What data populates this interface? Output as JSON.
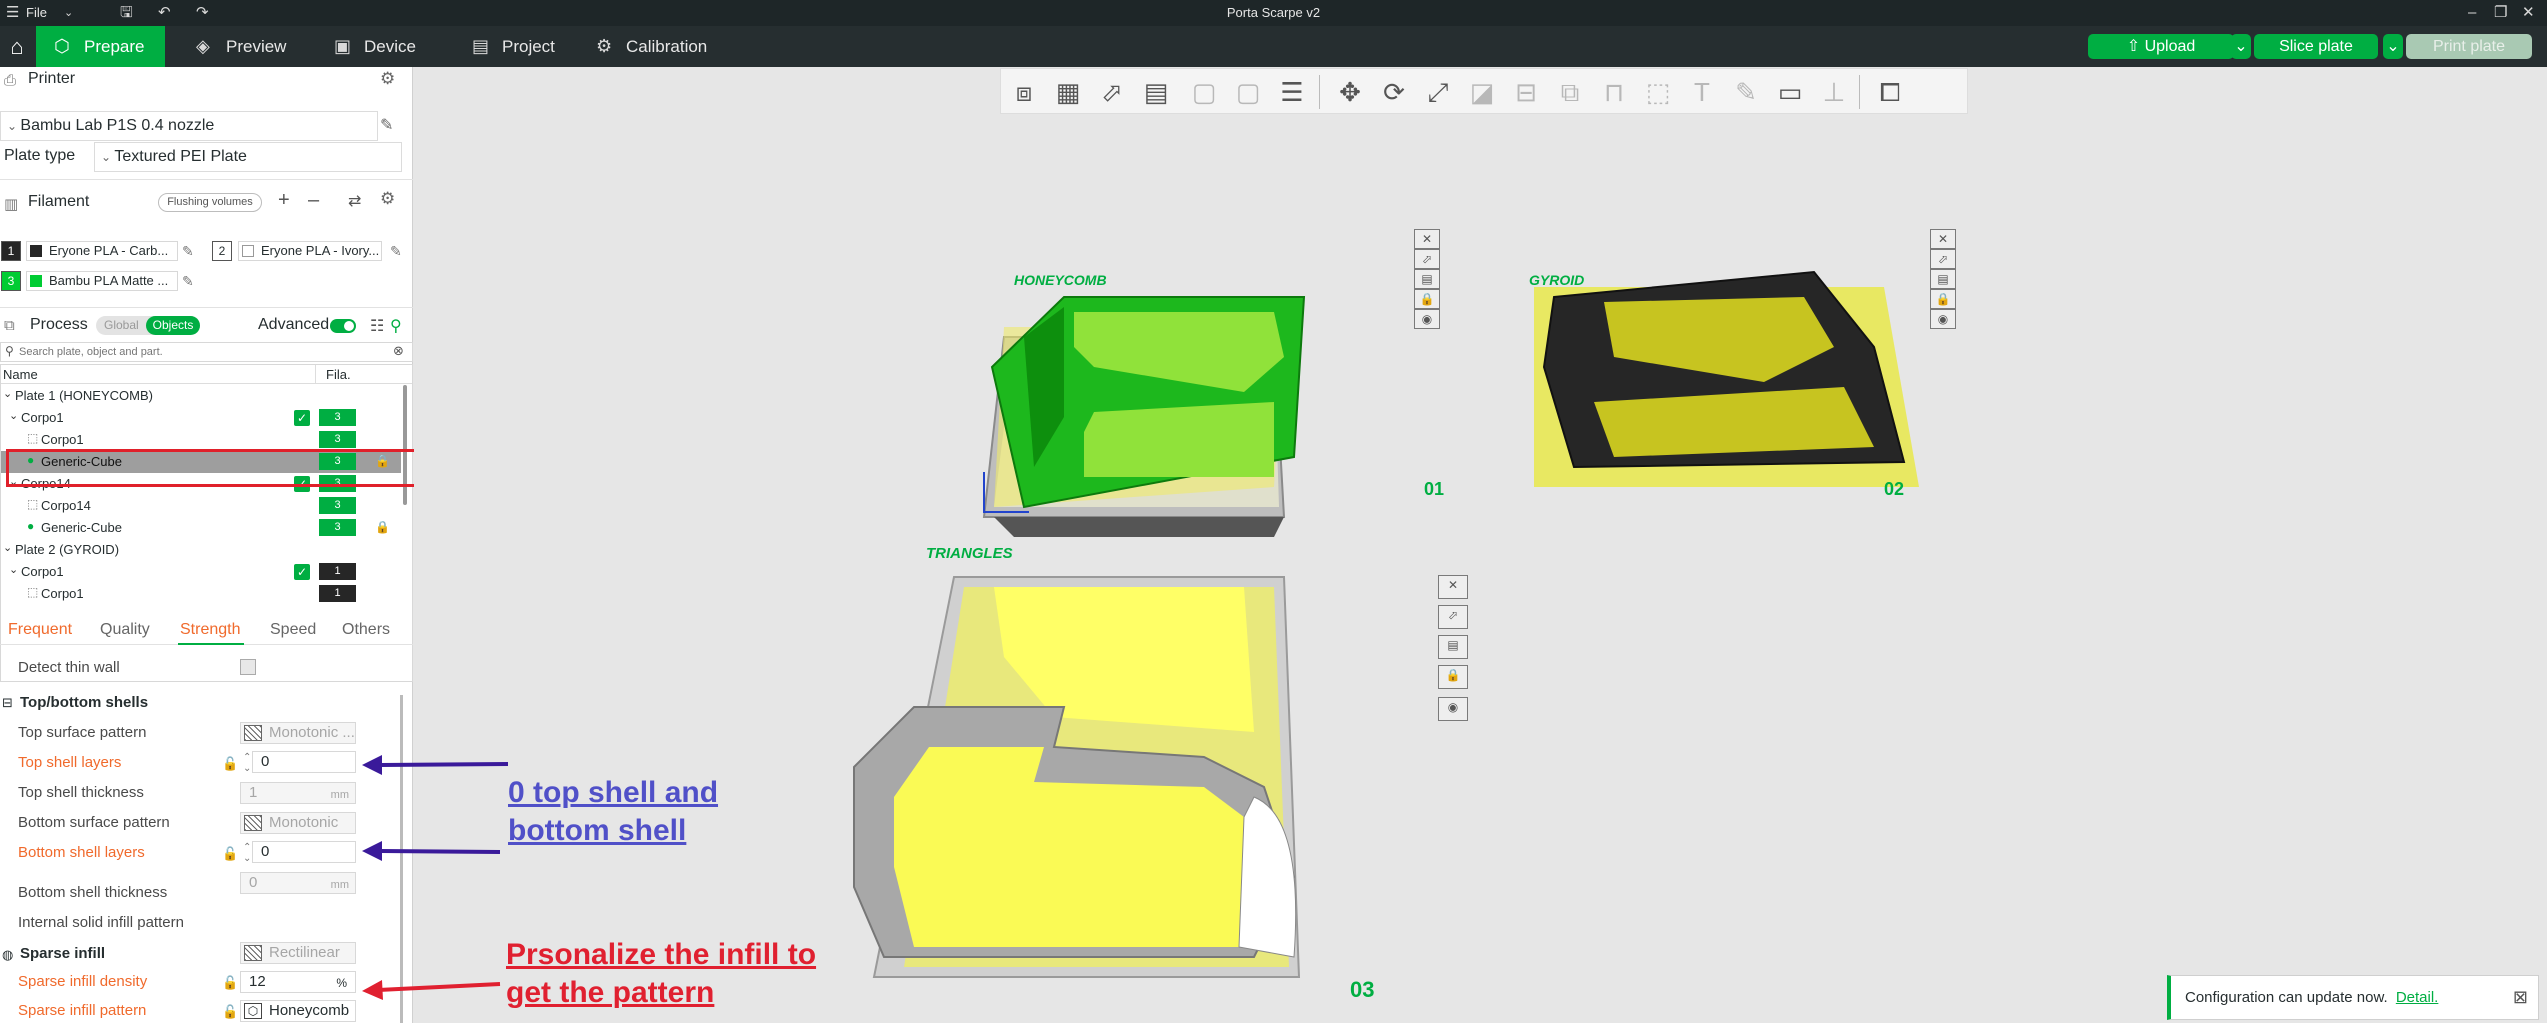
{
  "window": {
    "title": "Porta Scarpe v2",
    "menu_label": "File"
  },
  "tabs": [
    {
      "label": "Prepare",
      "icon": "cube-icon",
      "active": true
    },
    {
      "label": "Preview",
      "icon": "layers-icon"
    },
    {
      "label": "Device",
      "icon": "device-icon"
    },
    {
      "label": "Project",
      "icon": "project-icon"
    },
    {
      "label": "Calibration",
      "icon": "calibration-icon"
    }
  ],
  "actions": {
    "upload": "Upload",
    "slice": "Slice plate",
    "print": "Print plate"
  },
  "printer": {
    "section": "Printer",
    "name": "Bambu Lab P1S 0.4 nozzle",
    "plate_type_label": "Plate type",
    "plate_type": "Textured PEI Plate"
  },
  "filament": {
    "section": "Filament",
    "flush_label": "Flushing volumes",
    "items": [
      {
        "num": "1",
        "name": "Eryone PLA - Carb...",
        "color": "#262626"
      },
      {
        "num": "2",
        "name": "Eryone PLA - Ivory...",
        "color": "#ffffff"
      },
      {
        "num": "3",
        "name": "Bambu PLA Matte ...",
        "color": "#00cc33"
      }
    ]
  },
  "process": {
    "section": "Process",
    "toggle_global": "Global",
    "toggle_objects": "Objects",
    "advanced_label": "Advanced",
    "search_placeholder": "Search plate, object and part."
  },
  "object_list": {
    "col_name": "Name",
    "col_fila": "Fila.",
    "rows": [
      {
        "label": "Plate 1 (HONEYCOMB)",
        "level": 0,
        "fila": "",
        "check": false,
        "lock": false
      },
      {
        "label": "Corpo1",
        "level": 1,
        "fila": "3",
        "check": true,
        "lock": false
      },
      {
        "label": "Corpo1",
        "level": 2,
        "fila": "3",
        "check": false,
        "lock": false
      },
      {
        "label": "Generic-Cube",
        "level": 2,
        "fila": "3",
        "check": false,
        "lock": true,
        "selected": true
      },
      {
        "label": "Corpo14",
        "level": 1,
        "fila": "3",
        "check": true,
        "lock": false
      },
      {
        "label": "Corpo14",
        "level": 2,
        "fila": "3",
        "check": false,
        "lock": false
      },
      {
        "label": "Generic-Cube",
        "level": 2,
        "fila": "3",
        "check": false,
        "lock": true
      },
      {
        "label": "Plate 2 (GYROID)",
        "level": 0,
        "fila": "",
        "check": false,
        "lock": false
      },
      {
        "label": "Corpo1",
        "level": 1,
        "fila": "1",
        "check": true,
        "lock": false,
        "black": true
      },
      {
        "label": "Corpo1",
        "level": 2,
        "fila": "1",
        "check": false,
        "lock": false,
        "black": true
      }
    ]
  },
  "settings_tabs": [
    "Frequent",
    "Quality",
    "Strength",
    "Speed",
    "Others"
  ],
  "settings": {
    "detect_thin_wall": "Detect thin wall",
    "top_bottom_group": "Top/bottom shells",
    "top_surface_pattern": {
      "label": "Top surface pattern",
      "value": "Monotonic ..."
    },
    "top_shell_layers": {
      "label": "Top shell layers",
      "value": "0"
    },
    "top_shell_thickness": {
      "label": "Top shell thickness",
      "value": "1",
      "unit": "mm"
    },
    "bottom_surface_pattern": {
      "label": "Bottom surface pattern",
      "value": "Monotonic"
    },
    "bottom_shell_layers": {
      "label": "Bottom shell layers",
      "value": "0"
    },
    "bottom_shell_thickness": {
      "label": "Bottom shell thickness",
      "value": "0",
      "unit": "mm"
    },
    "internal_solid_pattern": {
      "label": "Internal solid infill pattern",
      "value": "Rectilinear"
    },
    "sparse_group": "Sparse infill",
    "sparse_density": {
      "label": "Sparse infill density",
      "value": "12",
      "unit": "%"
    },
    "sparse_pattern": {
      "label": "Sparse infill pattern",
      "value": "Honeycomb"
    }
  },
  "plates": [
    {
      "label": "HONEYCOMB",
      "num": "01"
    },
    {
      "label": "GYROID",
      "num": "02"
    },
    {
      "label": "TRIANGLES",
      "num": "03"
    }
  ],
  "annotations": {
    "shell_line1": "0 top shell and",
    "shell_line2": "bottom shell",
    "infill_line1": "Prsonalize the infill to",
    "infill_line2": "get the pattern"
  },
  "notification": {
    "text": "Configuration can update now.",
    "link": "Detail."
  }
}
